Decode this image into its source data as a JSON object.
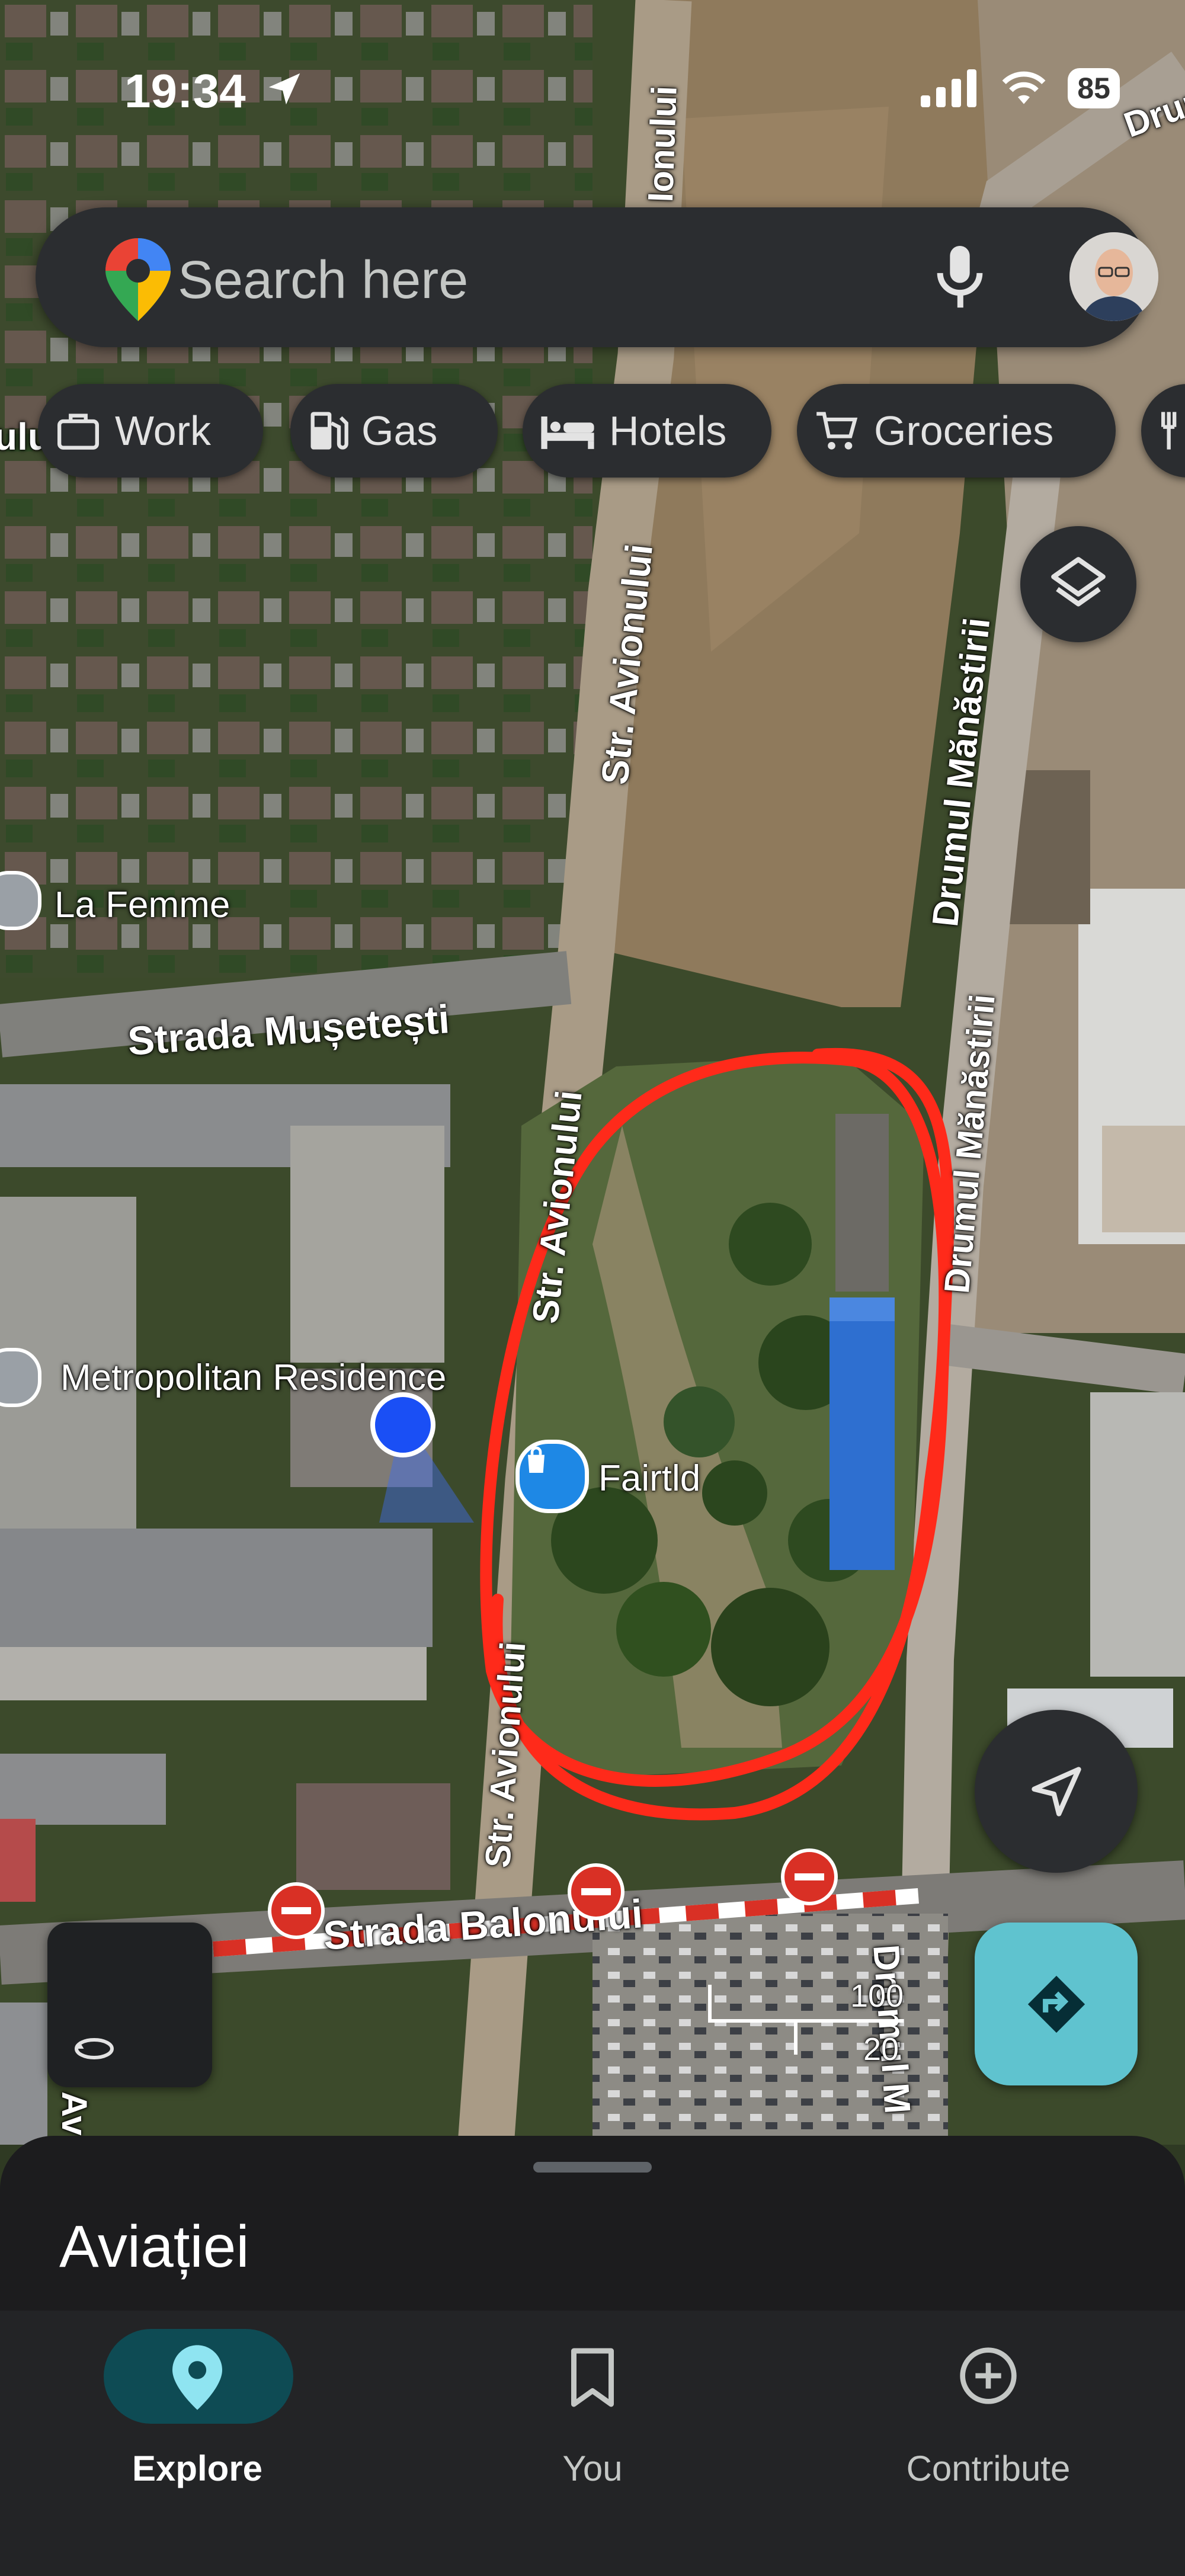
{
  "status_bar": {
    "time": "19:34",
    "battery": "85"
  },
  "search": {
    "placeholder": "Search here"
  },
  "chips": [
    {
      "label": "Work",
      "icon": "briefcase-icon"
    },
    {
      "label": "Gas",
      "icon": "gas-pump-icon"
    },
    {
      "label": "Hotels",
      "icon": "bed-icon"
    },
    {
      "label": "Groceries",
      "icon": "cart-icon"
    }
  ],
  "map": {
    "streets": {
      "avionului_top": "Str. Avionului",
      "avionului_mid": "Str. Avionului",
      "avionului_bottom": "Str. Avionului",
      "musetesti": "Strada Mușetești",
      "manastirii_top": "Drumul Mănăstirii",
      "manastirii_mid": "Drumul Mănăstirii",
      "manastirii_bottom": "Drumul M",
      "balonului": "Strada Balonului",
      "ionului_top": "Ionului",
      "drum_corner": "Drum",
      "ulu_edge": "ulu",
      "av_edge": "Av"
    },
    "places": [
      {
        "name": "La Femme",
        "icon": "place-pin-icon"
      },
      {
        "name": "Metropolitan Residence",
        "icon": "place-pin-icon"
      },
      {
        "name": "Fairtld",
        "icon": "shopping-bag-pin-icon"
      }
    ],
    "scale": {
      "top": "100",
      "bottom": "20"
    },
    "annotation_color": "#ff2a1a",
    "my_location_color": "#1a4ff5",
    "no_entry_color": "#d93025"
  },
  "sheet": {
    "title": "Aviației"
  },
  "nav": [
    {
      "label": "Explore",
      "icon": "location-pin-icon",
      "active": true
    },
    {
      "label": "You",
      "icon": "bookmark-icon",
      "active": false
    },
    {
      "label": "Contribute",
      "icon": "add-circle-icon",
      "active": false
    }
  ],
  "colors": {
    "accent": "#62c8d8",
    "nav_active": "#0e4b54",
    "directions_button": "#5fc3cf"
  }
}
